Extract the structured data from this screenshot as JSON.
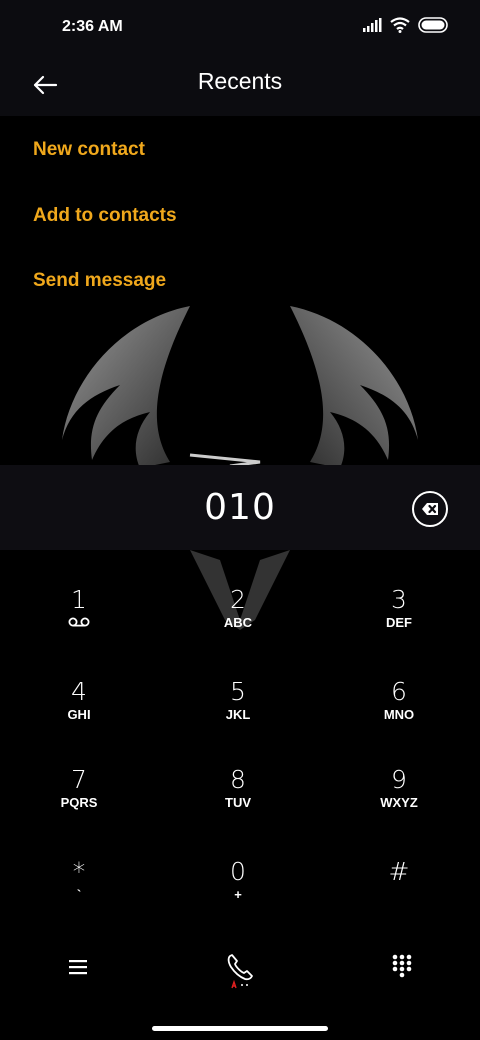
{
  "status": {
    "time": "2:36 AM"
  },
  "header": {
    "title": "Recents"
  },
  "menu": [
    "New contact",
    "Add to contacts",
    "Send message"
  ],
  "dialer": {
    "number": "010"
  },
  "keys": [
    {
      "digit": "1",
      "letters": ""
    },
    {
      "digit": "2",
      "letters": "ABC"
    },
    {
      "digit": "3",
      "letters": "DEF"
    },
    {
      "digit": "4",
      "letters": "GHI"
    },
    {
      "digit": "5",
      "letters": "JKL"
    },
    {
      "digit": "6",
      "letters": "MNO"
    },
    {
      "digit": "7",
      "letters": "PQRS"
    },
    {
      "digit": "8",
      "letters": "TUV"
    },
    {
      "digit": "9",
      "letters": "WXYZ"
    },
    {
      "digit": "*",
      "letters": "`"
    },
    {
      "digit": "0",
      "letters": "+"
    },
    {
      "digit": "#",
      "letters": ""
    }
  ],
  "colors": {
    "accent": "#f0a81c",
    "background": "#000000",
    "panel": "#0e0d12"
  },
  "icons": {
    "back": "arrow-left-icon",
    "backspace": "backspace-icon",
    "voicemail": "voicemail-icon",
    "menu": "hamburger-menu-icon",
    "call": "phone-icon",
    "keypad": "dialpad-icon"
  }
}
